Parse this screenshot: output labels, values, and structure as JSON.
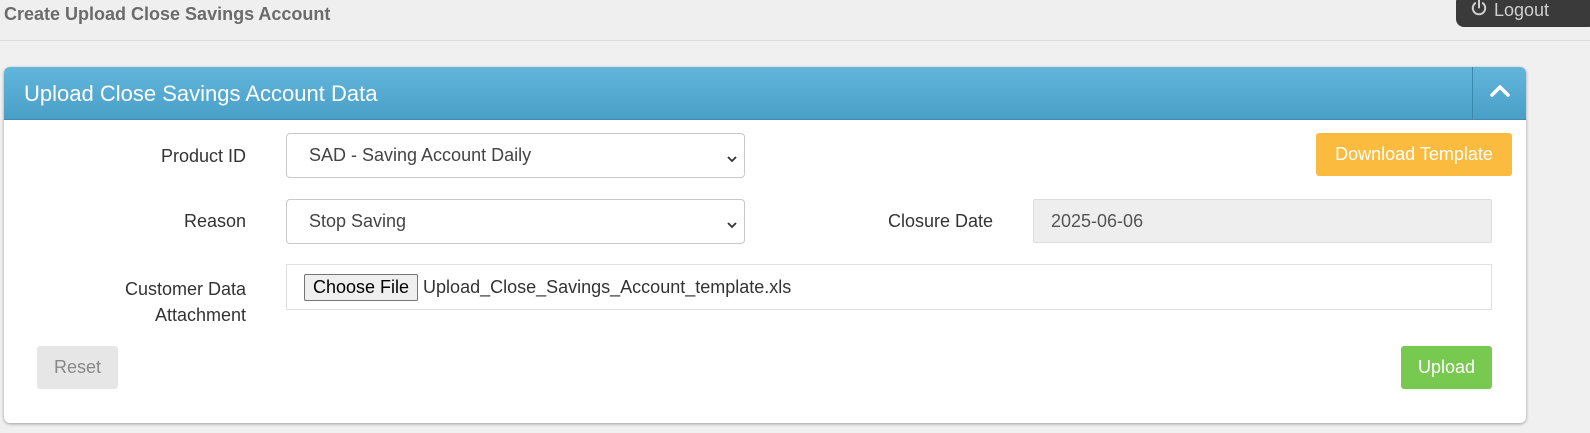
{
  "page": {
    "title": "Create Upload Close Savings Account"
  },
  "header": {
    "logout_label": "Logout"
  },
  "panel": {
    "title": "Upload Close Savings Account Data",
    "header_color": "#55a9d1"
  },
  "form": {
    "product_id": {
      "label": "Product ID",
      "selected": "SAD - Saving Account Daily"
    },
    "reason": {
      "label": "Reason",
      "selected": "Stop Saving"
    },
    "closure_date": {
      "label": "Closure Date",
      "value": "2025-06-06"
    },
    "attachment": {
      "label_line1": "Customer Data",
      "label_line2": "Attachment",
      "button_label": "Choose File",
      "file_name": "Upload_Close_Savings_Account_template.xls"
    }
  },
  "buttons": {
    "download_template": "Download Template",
    "reset": "Reset",
    "upload": "Upload"
  },
  "colors": {
    "template_button": "#fbbb3f",
    "upload_button": "#77c94f",
    "reset_button": "#e6e6e6"
  },
  "icons": {
    "logout": "power-icon",
    "collapse": "chevron-up-icon",
    "select": "chevron-down-icon"
  }
}
